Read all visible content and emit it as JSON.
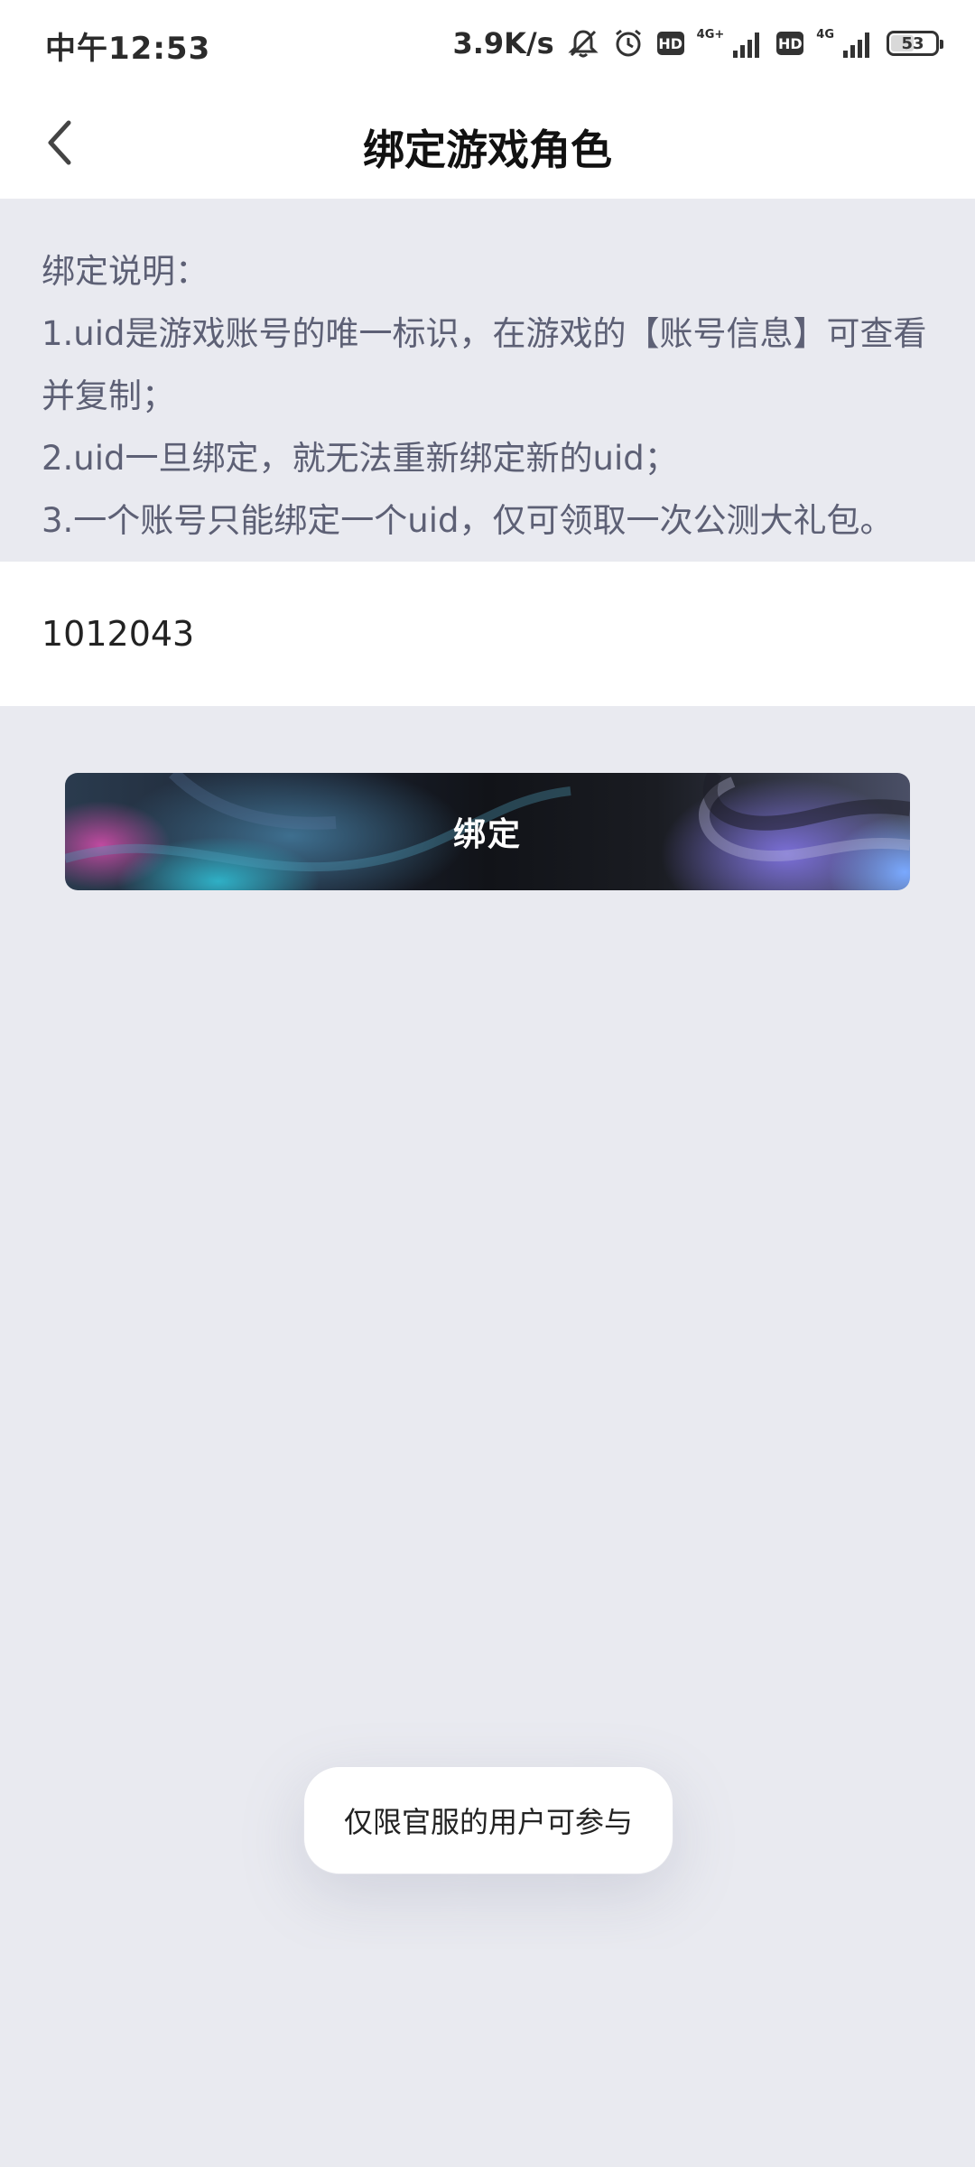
{
  "status_bar": {
    "time": "中午12:53",
    "net_speed": "3.9K/s",
    "sim1_type": "4G+",
    "sim2_type": "4G",
    "hd_label": "HD",
    "battery_level": "53",
    "battery_fraction": 0.53,
    "icons": [
      "mute-bell-icon",
      "alarm-icon",
      "hd-icon",
      "signal-icon",
      "hd-icon",
      "signal-icon",
      "battery-icon"
    ]
  },
  "header": {
    "title": "绑定游戏角色",
    "back_icon": "chevron-left-icon"
  },
  "instructions": {
    "heading": "绑定说明：",
    "lines": [
      "1.uid是游戏账号的唯一标识，在游戏的【账号信息】可查看",
      "并复制；",
      "2.uid一旦绑定，就无法重新绑定新的uid；",
      "3.一个账号只能绑定一个uid，仅可领取一次公测大礼包。"
    ]
  },
  "uid_input": {
    "value": "1012043",
    "placeholder": ""
  },
  "bind_button": {
    "label": "绑定"
  },
  "toast": {
    "message": "仅限官服的用户可参与"
  },
  "colors": {
    "page_background": "#e9eaf0",
    "instruction_text": "#5d6075",
    "title_text": "#111111",
    "button_text": "#ffffff"
  }
}
